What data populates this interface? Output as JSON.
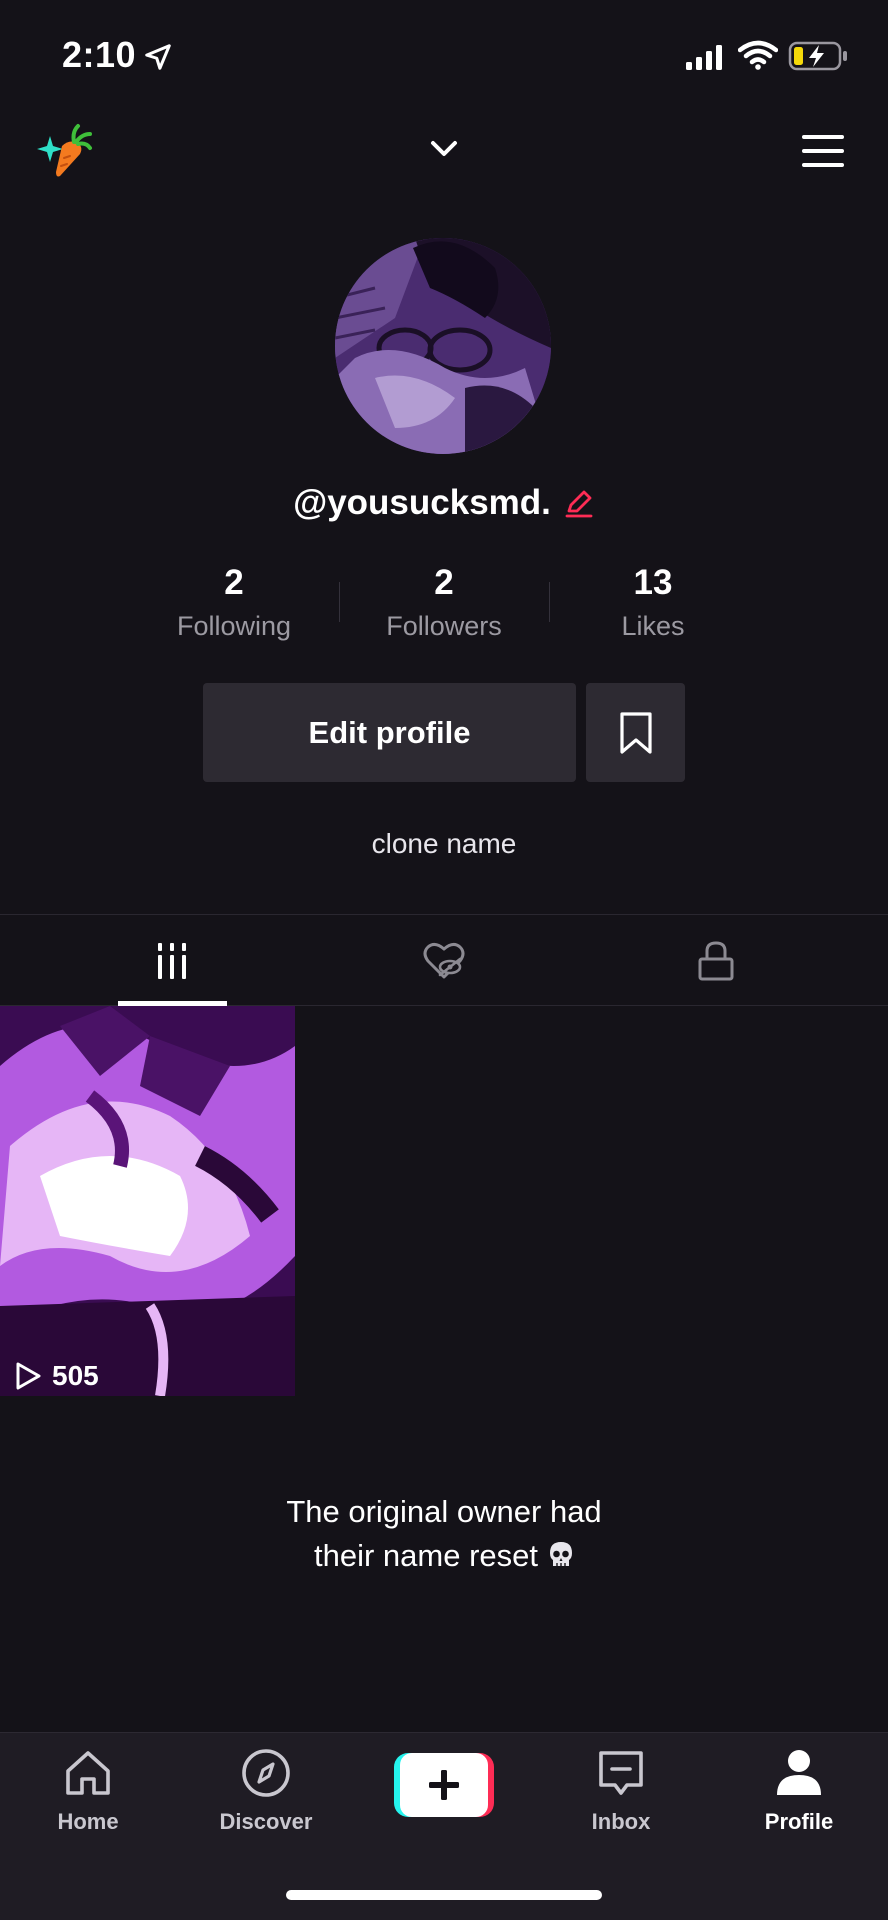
{
  "status_bar": {
    "time": "2:10",
    "icons": [
      "location-arrow-icon",
      "cell-signal-icon",
      "wifi-icon",
      "battery-charging-icon"
    ]
  },
  "top_nav": {
    "icons": [
      "app-logo-icon",
      "chevron-down-icon",
      "hamburger-menu-icon"
    ]
  },
  "profile": {
    "username": "@yousucksmd.",
    "stats": [
      {
        "value": "2",
        "label": "Following"
      },
      {
        "value": "2",
        "label": "Followers"
      },
      {
        "value": "13",
        "label": "Likes"
      }
    ],
    "edit_profile_label": "Edit profile",
    "bio": "clone name"
  },
  "tabs": [
    {
      "icon": "videos-grid-icon",
      "active": true
    },
    {
      "icon": "liked-hidden-icon",
      "active": false
    },
    {
      "icon": "lock-icon",
      "active": false
    }
  ],
  "videos": [
    {
      "play_count": "505"
    }
  ],
  "caption": {
    "line1": "The original owner had",
    "line2": "their name reset"
  },
  "bottom_nav": [
    {
      "label": "Home",
      "icon": "home-icon"
    },
    {
      "label": "Discover",
      "icon": "compass-icon"
    },
    {
      "label": "",
      "icon": "plus-icon"
    },
    {
      "label": "Inbox",
      "icon": "inbox-icon"
    },
    {
      "label": "Profile",
      "icon": "profile-icon",
      "active": true
    }
  ],
  "colors": {
    "background": "#141218",
    "accent": "#fe2c55",
    "accent_secondary": "#25f4ee",
    "button": "#2d2a32",
    "muted_text": "#9c9aa2"
  }
}
